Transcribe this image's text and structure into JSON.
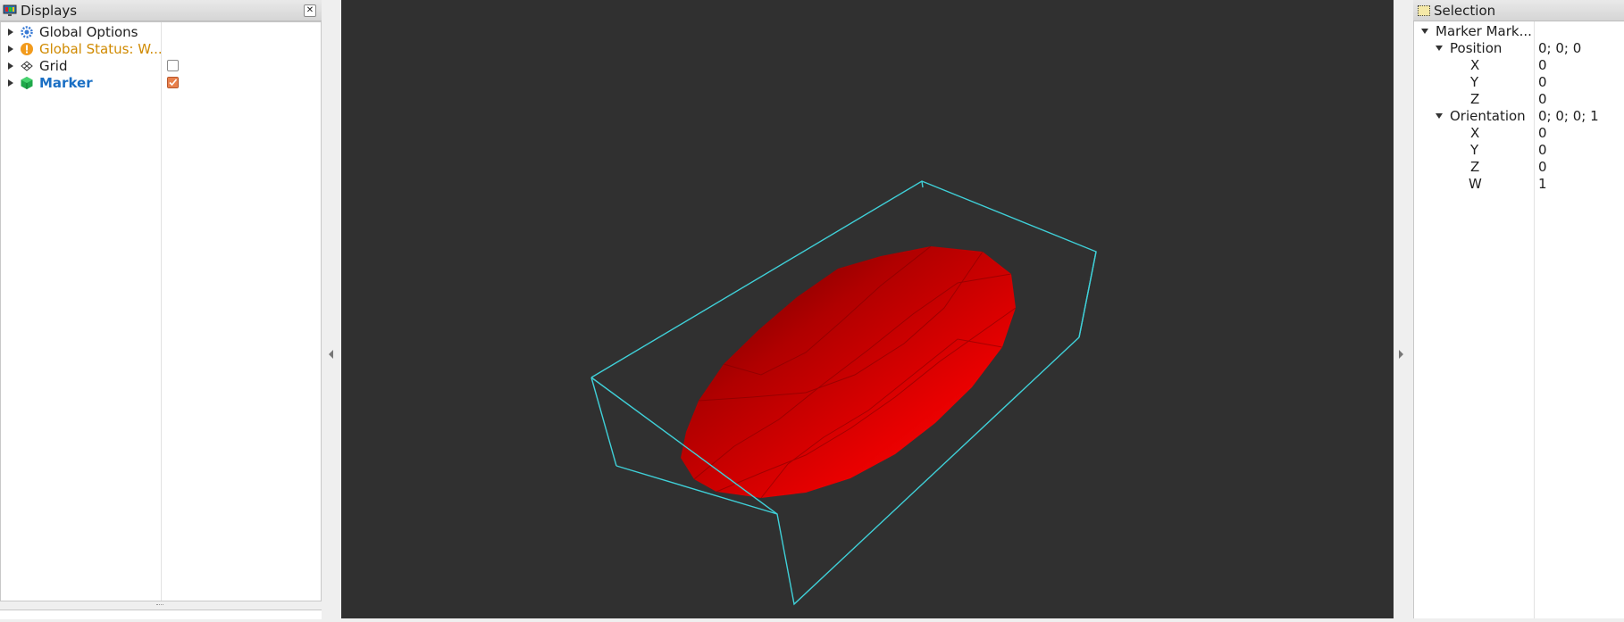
{
  "displays_panel": {
    "title": "Displays",
    "items": [
      {
        "label": "Global Options",
        "color": "#1e1e1e",
        "icon": "gear-icon"
      },
      {
        "label": "Global Status: W...",
        "color": "#d08a00",
        "icon": "warning-icon"
      },
      {
        "label": "Grid",
        "color": "#1e1e1e",
        "icon": "grid-icon",
        "checked": false
      },
      {
        "label": "Marker",
        "color": "#1a6fc4",
        "icon": "marker-cube-icon",
        "checked": true
      }
    ]
  },
  "selection_panel": {
    "title": "Selection",
    "root": "Marker Mark...",
    "position": {
      "label": "Position",
      "value": "0; 0; 0",
      "fields": [
        {
          "k": "X",
          "v": "0"
        },
        {
          "k": "Y",
          "v": "0"
        },
        {
          "k": "Z",
          "v": "0"
        }
      ]
    },
    "orientation": {
      "label": "Orientation",
      "value": "0; 0; 0; 1",
      "fields": [
        {
          "k": "X",
          "v": "0"
        },
        {
          "k": "Y",
          "v": "0"
        },
        {
          "k": "Z",
          "v": "0"
        },
        {
          "k": "W",
          "v": "1"
        }
      ]
    }
  },
  "viewport": {
    "background": "#303030",
    "bbox_color": "#3fd0d8",
    "marker_color": "#e00000"
  }
}
